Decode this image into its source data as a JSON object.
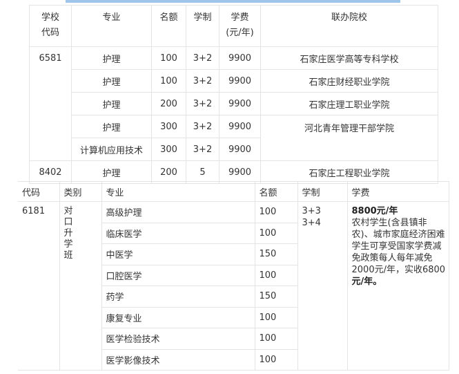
{
  "table1": {
    "headers": {
      "school_code_line1": "学校",
      "school_code_line2": "代码",
      "major": "专业",
      "quota": "名额",
      "duration": "学制",
      "fee_line1": "学费",
      "fee_line2": "(元/年)",
      "partner": "联办院校"
    },
    "rows": [
      {
        "major": "护理",
        "quota": "100",
        "duration": "3+2",
        "fee": "9900"
      },
      {
        "major": "护理",
        "quota": "100",
        "duration": "3+2",
        "fee": "9900"
      },
      {
        "major": "护理",
        "quota": "200",
        "duration": "3+2",
        "fee": "9900"
      },
      {
        "major": "护理",
        "quota": "300",
        "duration": "3+2",
        "fee": "9900"
      },
      {
        "major": "计算机应用技术",
        "quota": "300",
        "duration": "3+2",
        "fee": "9900"
      },
      {
        "major": "护理",
        "quota": "200",
        "duration": "5",
        "fee": "9900"
      }
    ],
    "codes": [
      "6581",
      "8402"
    ],
    "partners": [
      "石家庄医学高等专科学校",
      "石家庄财经职业学院",
      "石家庄理工职业学院",
      "河北青年管理干部学院",
      "石家庄工程职业学院"
    ]
  },
  "table2": {
    "headers": {
      "code": "代码",
      "category": "类别",
      "major": "专业",
      "quota": "名额",
      "duration": "学制",
      "fee": "学费"
    },
    "code": "6181",
    "category_chars": [
      "对",
      "口",
      "升",
      "学",
      "班"
    ],
    "durations": [
      "3+3",
      "3+4"
    ],
    "fee": {
      "amount": "8800元/年",
      "note": "农村学生(含县镇非农)、城市家庭经济困难学生可享受国家学费减免政策每人每年减免2000元/年，实收6800",
      "note_end": "元/年。"
    },
    "rows": [
      {
        "major": "高级护理",
        "quota": "100"
      },
      {
        "major": "临床医学",
        "quota": "100"
      },
      {
        "major": "中医学",
        "quota": "150"
      },
      {
        "major": "口腔医学",
        "quota": "100"
      },
      {
        "major": "药学",
        "quota": "150"
      },
      {
        "major": "康复专业",
        "quota": "100"
      },
      {
        "major": "医学检验技术",
        "quota": "100"
      },
      {
        "major": "医学影像技术",
        "quota": "100"
      }
    ]
  }
}
